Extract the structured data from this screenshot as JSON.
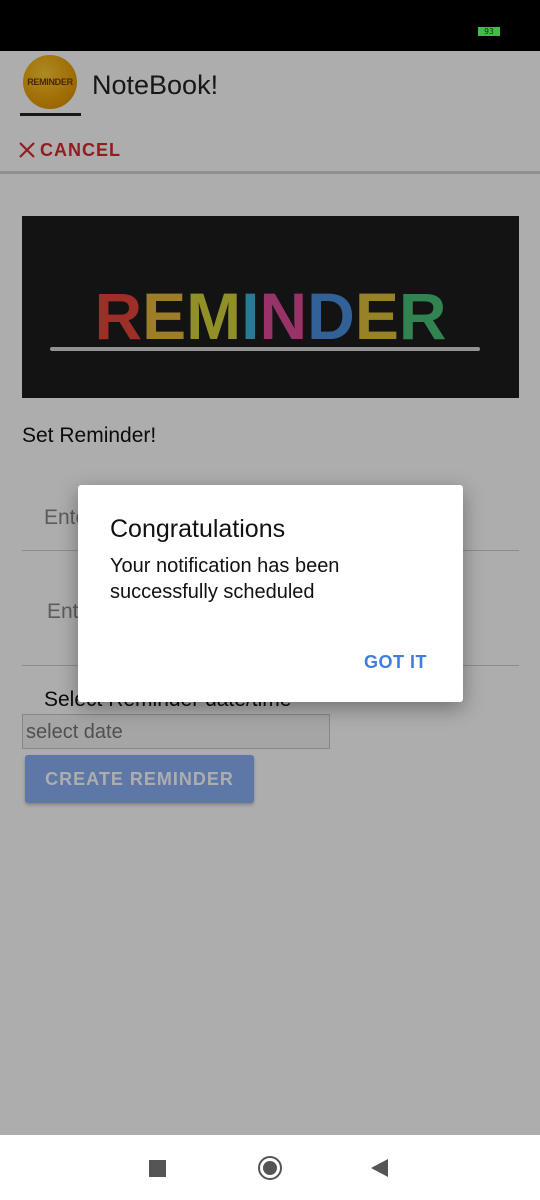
{
  "status_bar": {
    "battery": "93"
  },
  "app_bar": {
    "logo_text": "REMINDER",
    "title": "NoteBook!",
    "cancel_label": "CANCEL"
  },
  "form": {
    "banner_text": "REMINDER",
    "banner_letter_colors": [
      "#e8453c",
      "#e8b93c",
      "#d6d43a",
      "#3cb4e0",
      "#e04a9a",
      "#4b8fe0",
      "#e0c03a",
      "#49c27a"
    ],
    "heading": "Set Reminder!",
    "field1_placeholder": "Ente",
    "field2_placeholder": "Ent",
    "date_label": "Select Reminder date/time",
    "date_placeholder": "select date",
    "create_button": "CREATE REMINDER"
  },
  "dialog": {
    "title": "Congratulations",
    "message": "Your notification has been successfully scheduled",
    "button": "GOT IT"
  },
  "nav": {
    "recents": "square-icon",
    "home": "circle-icon",
    "back": "triangle-back-icon"
  },
  "colors": {
    "accent": "#3d7fe0",
    "cancel": "#d32f2f",
    "button": "#8ab0f5"
  }
}
